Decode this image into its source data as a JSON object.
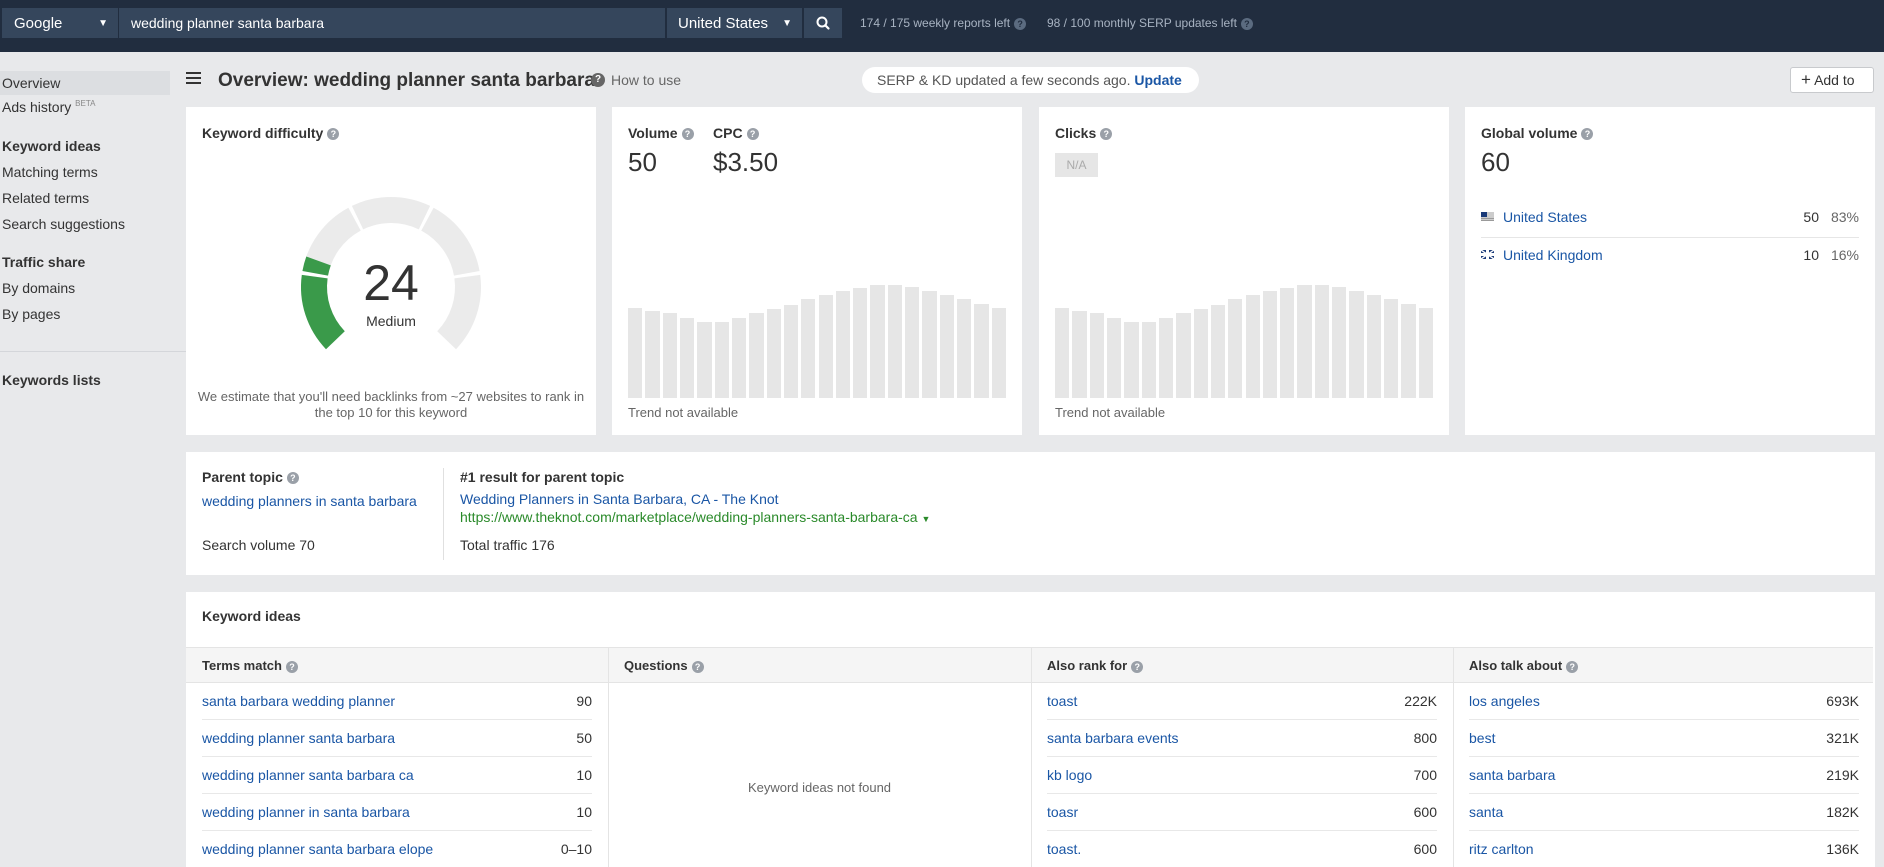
{
  "topbar": {
    "engine": "Google",
    "search_value": "wedding planner santa barbara",
    "country": "United States",
    "weekly_reports": "174 / 175 weekly reports left",
    "monthly_serp": "98 / 100 monthly SERP updates left"
  },
  "sidebar": {
    "overview": "Overview",
    "ads_history": "Ads history",
    "ads_beta": "BETA",
    "keyword_ideas_head": "Keyword ideas",
    "matching_terms": "Matching terms",
    "related_terms": "Related terms",
    "search_suggestions": "Search suggestions",
    "traffic_share_head": "Traffic share",
    "by_domains": "By domains",
    "by_pages": "By pages",
    "keywords_lists": "Keywords lists"
  },
  "header": {
    "title": "Overview: wedding planner santa barbara",
    "how_to_use": "How to use",
    "serp_status": "SERP & KD updated a few seconds ago.",
    "update_link": "Update",
    "add_to": "Add to"
  },
  "kd": {
    "label": "Keyword difficulty",
    "value": "24",
    "level": "Medium",
    "score_fraction": 0.24,
    "estimate": "We estimate that you'll need backlinks from ~27 websites to rank in the top 10 for this keyword"
  },
  "volume": {
    "label": "Volume",
    "value": "50",
    "cpc_label": "CPC",
    "cpc_value": "$3.50",
    "trend_note": "Trend not available"
  },
  "clicks": {
    "label": "Clicks",
    "value": "N/A",
    "trend_note": "Trend not available"
  },
  "global_volume": {
    "label": "Global volume",
    "value": "60",
    "countries": [
      {
        "name": "United States",
        "volume": "50",
        "pct": "83%"
      },
      {
        "name": "United Kingdom",
        "volume": "10",
        "pct": "16%"
      }
    ]
  },
  "parent_topic": {
    "label": "Parent topic",
    "topic": "wedding planners in santa barbara",
    "search_volume": "Search volume 70",
    "result_label": "#1 result for parent topic",
    "result_title": "Wedding Planners in Santa Barbara, CA - The Knot",
    "result_url": "https://www.theknot.com/marketplace/wedding-planners-santa-barbara-ca",
    "total_traffic": "Total traffic 176"
  },
  "keyword_ideas": {
    "title": "Keyword ideas",
    "terms_match": {
      "header": "Terms match",
      "rows": [
        {
          "kw": "santa barbara wedding planner",
          "v": "90"
        },
        {
          "kw": "wedding planner santa barbara",
          "v": "50"
        },
        {
          "kw": "wedding planner santa barbara ca",
          "v": "10"
        },
        {
          "kw": "wedding planner in santa barbara",
          "v": "10"
        },
        {
          "kw": "wedding planner santa barbara elope",
          "v": "0–10"
        }
      ]
    },
    "questions": {
      "header": "Questions",
      "empty": "Keyword ideas not found"
    },
    "also_rank_for": {
      "header": "Also rank for",
      "rows": [
        {
          "kw": "toast",
          "v": "222K"
        },
        {
          "kw": "santa barbara events",
          "v": "800"
        },
        {
          "kw": "kb logo",
          "v": "700"
        },
        {
          "kw": "toasr",
          "v": "600"
        },
        {
          "kw": "toast.",
          "v": "600"
        }
      ]
    },
    "also_talk_about": {
      "header": "Also talk about",
      "rows": [
        {
          "kw": "los angeles",
          "v": "693K"
        },
        {
          "kw": "best",
          "v": "321K"
        },
        {
          "kw": "santa barbara",
          "v": "219K"
        },
        {
          "kw": "santa",
          "v": "182K"
        },
        {
          "kw": "ritz carlton",
          "v": "136K"
        }
      ]
    }
  },
  "colors": {
    "topbar_bg": "#212d3f",
    "link": "#1a56a5",
    "kd_green": "#3a9a4a",
    "url_green": "#2a8a2a"
  }
}
